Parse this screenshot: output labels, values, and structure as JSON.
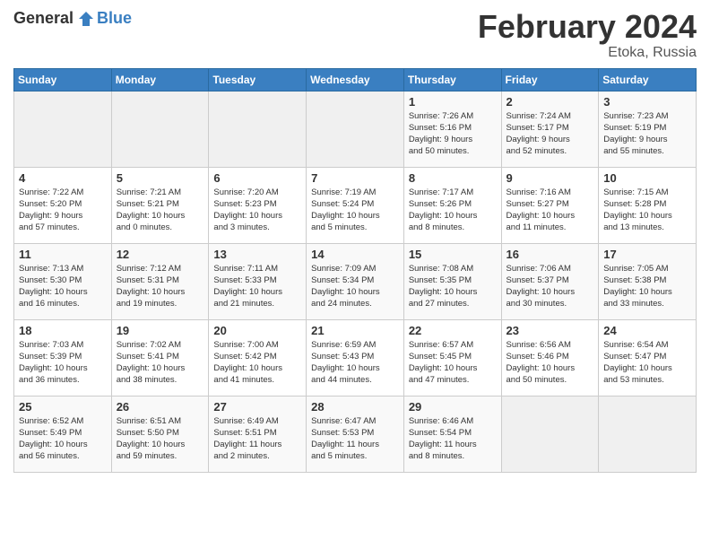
{
  "header": {
    "logo_general": "General",
    "logo_blue": "Blue",
    "month_year": "February 2024",
    "location": "Etoka, Russia"
  },
  "days_of_week": [
    "Sunday",
    "Monday",
    "Tuesday",
    "Wednesday",
    "Thursday",
    "Friday",
    "Saturday"
  ],
  "weeks": [
    [
      {
        "day": "",
        "info": ""
      },
      {
        "day": "",
        "info": ""
      },
      {
        "day": "",
        "info": ""
      },
      {
        "day": "",
        "info": ""
      },
      {
        "day": "1",
        "info": "Sunrise: 7:26 AM\nSunset: 5:16 PM\nDaylight: 9 hours\nand 50 minutes."
      },
      {
        "day": "2",
        "info": "Sunrise: 7:24 AM\nSunset: 5:17 PM\nDaylight: 9 hours\nand 52 minutes."
      },
      {
        "day": "3",
        "info": "Sunrise: 7:23 AM\nSunset: 5:19 PM\nDaylight: 9 hours\nand 55 minutes."
      }
    ],
    [
      {
        "day": "4",
        "info": "Sunrise: 7:22 AM\nSunset: 5:20 PM\nDaylight: 9 hours\nand 57 minutes."
      },
      {
        "day": "5",
        "info": "Sunrise: 7:21 AM\nSunset: 5:21 PM\nDaylight: 10 hours\nand 0 minutes."
      },
      {
        "day": "6",
        "info": "Sunrise: 7:20 AM\nSunset: 5:23 PM\nDaylight: 10 hours\nand 3 minutes."
      },
      {
        "day": "7",
        "info": "Sunrise: 7:19 AM\nSunset: 5:24 PM\nDaylight: 10 hours\nand 5 minutes."
      },
      {
        "day": "8",
        "info": "Sunrise: 7:17 AM\nSunset: 5:26 PM\nDaylight: 10 hours\nand 8 minutes."
      },
      {
        "day": "9",
        "info": "Sunrise: 7:16 AM\nSunset: 5:27 PM\nDaylight: 10 hours\nand 11 minutes."
      },
      {
        "day": "10",
        "info": "Sunrise: 7:15 AM\nSunset: 5:28 PM\nDaylight: 10 hours\nand 13 minutes."
      }
    ],
    [
      {
        "day": "11",
        "info": "Sunrise: 7:13 AM\nSunset: 5:30 PM\nDaylight: 10 hours\nand 16 minutes."
      },
      {
        "day": "12",
        "info": "Sunrise: 7:12 AM\nSunset: 5:31 PM\nDaylight: 10 hours\nand 19 minutes."
      },
      {
        "day": "13",
        "info": "Sunrise: 7:11 AM\nSunset: 5:33 PM\nDaylight: 10 hours\nand 21 minutes."
      },
      {
        "day": "14",
        "info": "Sunrise: 7:09 AM\nSunset: 5:34 PM\nDaylight: 10 hours\nand 24 minutes."
      },
      {
        "day": "15",
        "info": "Sunrise: 7:08 AM\nSunset: 5:35 PM\nDaylight: 10 hours\nand 27 minutes."
      },
      {
        "day": "16",
        "info": "Sunrise: 7:06 AM\nSunset: 5:37 PM\nDaylight: 10 hours\nand 30 minutes."
      },
      {
        "day": "17",
        "info": "Sunrise: 7:05 AM\nSunset: 5:38 PM\nDaylight: 10 hours\nand 33 minutes."
      }
    ],
    [
      {
        "day": "18",
        "info": "Sunrise: 7:03 AM\nSunset: 5:39 PM\nDaylight: 10 hours\nand 36 minutes."
      },
      {
        "day": "19",
        "info": "Sunrise: 7:02 AM\nSunset: 5:41 PM\nDaylight: 10 hours\nand 38 minutes."
      },
      {
        "day": "20",
        "info": "Sunrise: 7:00 AM\nSunset: 5:42 PM\nDaylight: 10 hours\nand 41 minutes."
      },
      {
        "day": "21",
        "info": "Sunrise: 6:59 AM\nSunset: 5:43 PM\nDaylight: 10 hours\nand 44 minutes."
      },
      {
        "day": "22",
        "info": "Sunrise: 6:57 AM\nSunset: 5:45 PM\nDaylight: 10 hours\nand 47 minutes."
      },
      {
        "day": "23",
        "info": "Sunrise: 6:56 AM\nSunset: 5:46 PM\nDaylight: 10 hours\nand 50 minutes."
      },
      {
        "day": "24",
        "info": "Sunrise: 6:54 AM\nSunset: 5:47 PM\nDaylight: 10 hours\nand 53 minutes."
      }
    ],
    [
      {
        "day": "25",
        "info": "Sunrise: 6:52 AM\nSunset: 5:49 PM\nDaylight: 10 hours\nand 56 minutes."
      },
      {
        "day": "26",
        "info": "Sunrise: 6:51 AM\nSunset: 5:50 PM\nDaylight: 10 hours\nand 59 minutes."
      },
      {
        "day": "27",
        "info": "Sunrise: 6:49 AM\nSunset: 5:51 PM\nDaylight: 11 hours\nand 2 minutes."
      },
      {
        "day": "28",
        "info": "Sunrise: 6:47 AM\nSunset: 5:53 PM\nDaylight: 11 hours\nand 5 minutes."
      },
      {
        "day": "29",
        "info": "Sunrise: 6:46 AM\nSunset: 5:54 PM\nDaylight: 11 hours\nand 8 minutes."
      },
      {
        "day": "",
        "info": ""
      },
      {
        "day": "",
        "info": ""
      }
    ]
  ]
}
